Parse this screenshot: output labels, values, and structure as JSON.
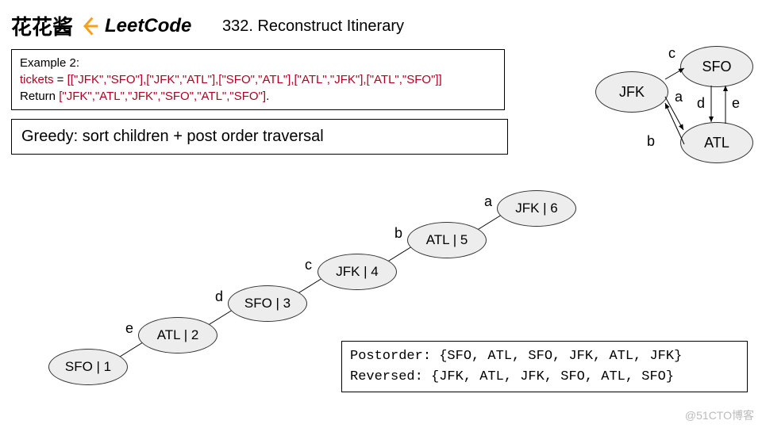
{
  "header": {
    "cn": "花花酱",
    "brand": "LeetCode",
    "title": "332. Reconstruct Itinerary"
  },
  "example": {
    "line1a": "Example 2:",
    "line2a": "tickets",
    "line2b": " = ",
    "line2c": "[[\"JFK\",\"SFO\"],[\"JFK\",\"ATL\"],[\"SFO\",\"ATL\"],[\"ATL\",\"JFK\"],[\"ATL\",\"SFO\"]]",
    "line3a": "Return ",
    "line3b": "[\"JFK\",\"ATL\",\"JFK\",\"SFO\",\"ATL\",\"SFO\"]",
    "line3c": "."
  },
  "greedy": "Greedy: sort children + post order traversal",
  "graph": {
    "nodes": {
      "jfk": "JFK",
      "sfo": "SFO",
      "atl": "ATL"
    },
    "edges": {
      "a": "a",
      "b": "b",
      "c": "c",
      "d": "d",
      "e": "e"
    }
  },
  "chain": {
    "n6": "JFK | 6",
    "n5": "ATL | 5",
    "n4": "JFK | 4",
    "n3": "SFO | 3",
    "n2": "ATL  | 2",
    "n1": "SFO | 1",
    "a": "a",
    "b": "b",
    "c": "c",
    "d": "d",
    "e": "e"
  },
  "postorder": {
    "l1": "Postorder: {SFO, ATL, SFO, JFK, ATL, JFK}",
    "l2": "Reversed:  {JFK, ATL, JFK, SFO, ATL, SFO}"
  },
  "watermark": "@51CTO博客"
}
